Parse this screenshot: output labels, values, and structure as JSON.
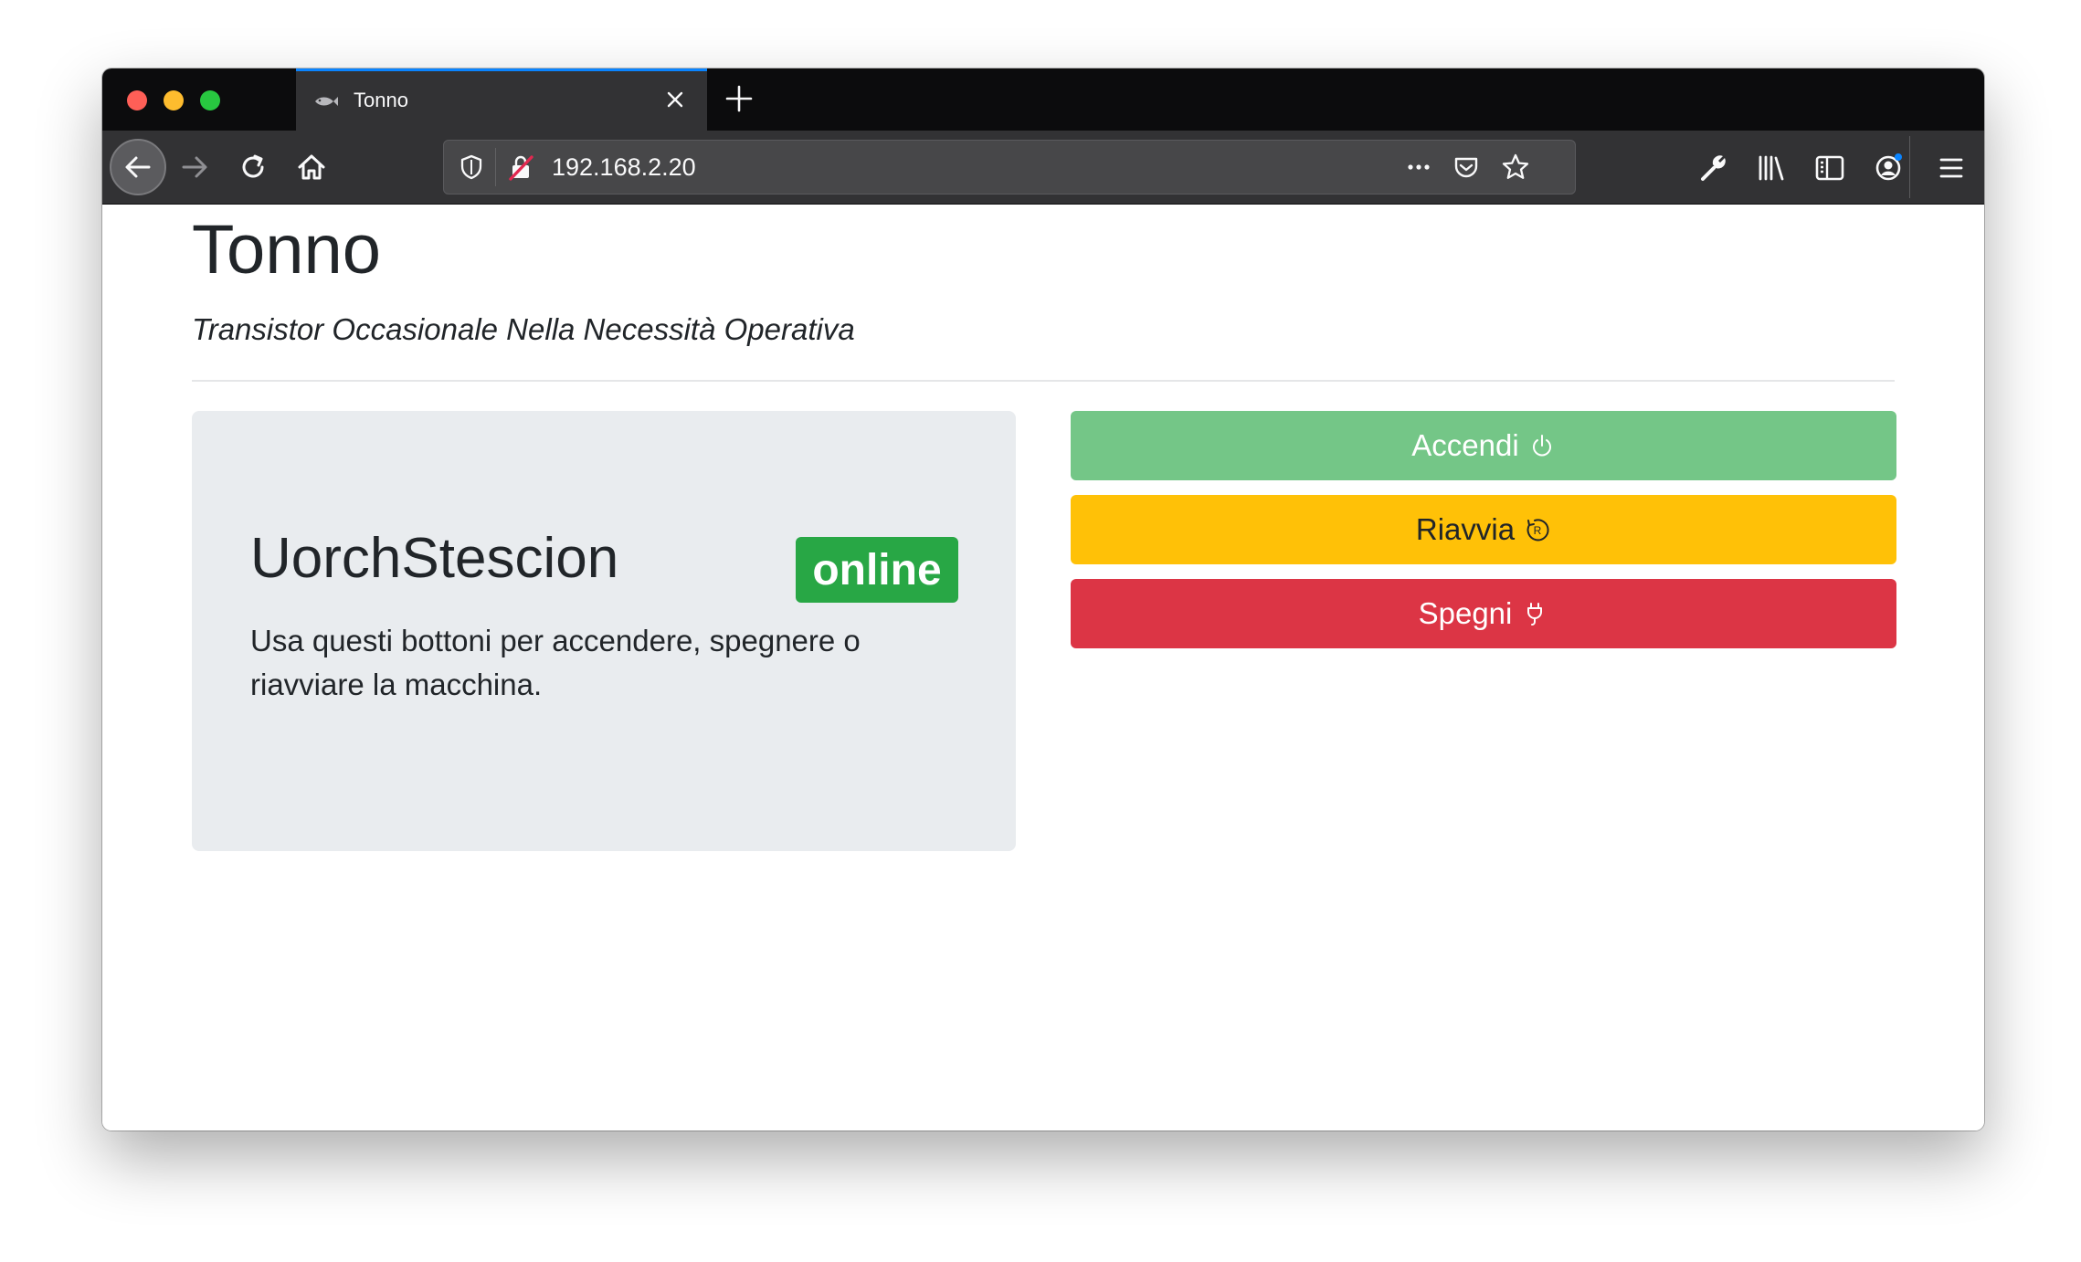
{
  "browser": {
    "tab_title": "Tonno",
    "url": "192.168.2.20"
  },
  "page": {
    "title": "Tonno",
    "subtitle": "Transistor Occasionale Nella Necessità Operativa"
  },
  "machine": {
    "name": "UorchStescion",
    "status": "online",
    "status_color": "#28a745",
    "description": "Usa questi bottoni per accendere, spegnere o riavviare la macchina."
  },
  "actions": {
    "power_on": {
      "label": "Accendi",
      "color": "#74c687",
      "icon": "power-icon"
    },
    "restart": {
      "label": "Riavvia",
      "color": "#ffc107",
      "icon": "restart-icon"
    },
    "power_off": {
      "label": "Spegni",
      "color": "#dc3545",
      "icon": "plug-icon"
    }
  }
}
